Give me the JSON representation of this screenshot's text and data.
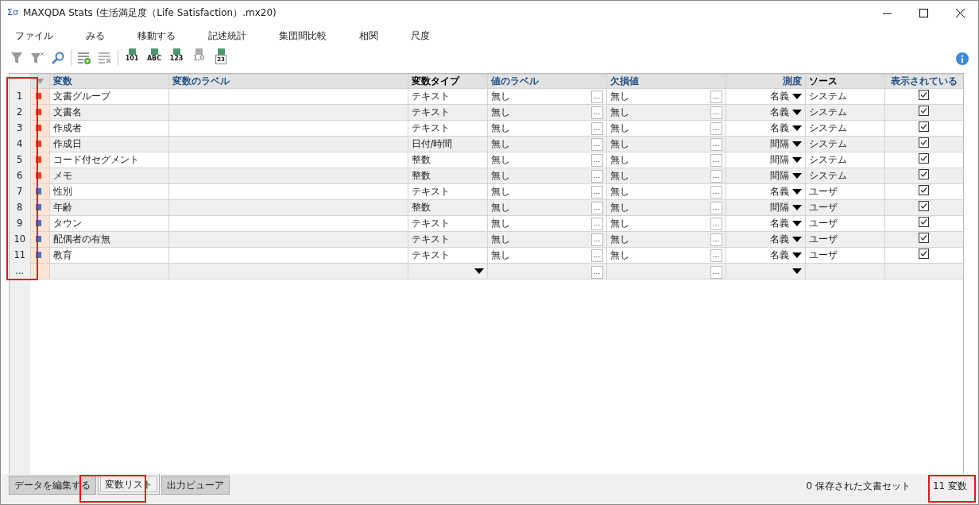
{
  "window": {
    "app_icon": "Σσ",
    "title": "MAXQDA Stats (生活満足度（Life Satisfaction）.mx20)"
  },
  "menu": [
    "ファイル",
    "みる",
    "移動する",
    "記述統計",
    "集団間比較",
    "相関",
    "尺度"
  ],
  "toolbar": [
    {
      "kind": "filter",
      "disabled": true
    },
    {
      "kind": "filter-clear",
      "disabled": true
    },
    {
      "kind": "search",
      "disabled": false
    },
    {
      "kind": "separator"
    },
    {
      "kind": "list-add",
      "disabled": false
    },
    {
      "kind": "list-remove",
      "disabled": true
    },
    {
      "kind": "separator"
    },
    {
      "kind": "convert",
      "label": "101",
      "disabled": false
    },
    {
      "kind": "convert",
      "label": "ABC",
      "disabled": false
    },
    {
      "kind": "convert",
      "label": "123",
      "disabled": false
    },
    {
      "kind": "convert",
      "label": "1,0",
      "disabled": true
    },
    {
      "kind": "calendar",
      "label": "23",
      "disabled": false
    }
  ],
  "table": {
    "columns": [
      {
        "label": "変数",
        "editable": true
      },
      {
        "label": "変数のラベル",
        "editable": true
      },
      {
        "label": "変数タイプ",
        "editable": false
      },
      {
        "label": "値のラベル",
        "editable": true
      },
      {
        "label": "欠損値",
        "editable": true
      },
      {
        "label": "測度",
        "editable": true
      },
      {
        "label": "ソース",
        "editable": false
      },
      {
        "label": "表示されている",
        "editable": true
      }
    ],
    "rows": [
      {
        "number": "1",
        "color": "#e8402a",
        "name": "文書グループ",
        "type": "テキスト",
        "value_label": "無し",
        "value_label_button": "...",
        "missing": "無し",
        "missing_button": "...",
        "measure": "名義",
        "source": "システム",
        "shown": true
      },
      {
        "number": "2",
        "color": "#e8402a",
        "name": "文書名",
        "type": "テキスト",
        "value_label": "無し",
        "value_label_button": "...",
        "missing": "無し",
        "missing_button": "...",
        "measure": "名義",
        "source": "システム",
        "shown": true
      },
      {
        "number": "3",
        "color": "#e8402a",
        "name": "作成者",
        "type": "テキスト",
        "value_label": "無し",
        "value_label_button": "...",
        "missing": "無し",
        "missing_button": "...",
        "measure": "名義",
        "source": "システム",
        "shown": true
      },
      {
        "number": "4",
        "color": "#e8402a",
        "name": "作成日",
        "type": "日付/時間",
        "value_label": "無し",
        "value_label_button": "...",
        "missing": "無し",
        "missing_button": "...",
        "measure": "間隔",
        "source": "システム",
        "shown": true
      },
      {
        "number": "5",
        "color": "#e8402a",
        "name": "コード付セグメント",
        "type": "整数",
        "value_label": "無し",
        "value_label_button": "...",
        "missing": "無し",
        "missing_button": "...",
        "measure": "間隔",
        "source": "システム",
        "shown": true
      },
      {
        "number": "6",
        "color": "#e8402a",
        "name": "メモ",
        "type": "整数",
        "value_label": "無し",
        "value_label_button": "...",
        "missing": "無し",
        "missing_button": "...",
        "measure": "間隔",
        "source": "システム",
        "shown": true
      },
      {
        "number": "7",
        "color": "#3d7ab8",
        "name": "性別",
        "type": "テキスト",
        "value_label": "無し",
        "value_label_button": "...",
        "missing": "無し",
        "missing_button": "...",
        "measure": "名義",
        "source": "ユーザ",
        "shown": true
      },
      {
        "number": "8",
        "color": "#3d7ab8",
        "name": "年齢",
        "type": "整数",
        "value_label": "無し",
        "value_label_button": "...",
        "missing": "無し",
        "missing_button": "...",
        "measure": "間隔",
        "source": "ユーザ",
        "shown": true
      },
      {
        "number": "9",
        "color": "#3d7ab8",
        "name": "タウン",
        "type": "テキスト",
        "value_label": "無し",
        "value_label_button": "...",
        "missing": "無し",
        "missing_button": "...",
        "measure": "名義",
        "source": "ユーザ",
        "shown": true
      },
      {
        "number": "10",
        "color": "#3d7ab8",
        "name": "配偶者の有無",
        "type": "テキスト",
        "value_label": "無し",
        "value_label_button": "...",
        "missing": "無し",
        "missing_button": "...",
        "measure": "名義",
        "source": "ユーザ",
        "shown": true
      },
      {
        "number": "11",
        "color": "#3d7ab8",
        "name": "教育",
        "type": "テキスト",
        "value_label": "無し",
        "value_label_button": "...",
        "missing": "無し",
        "missing_button": "...",
        "measure": "名義",
        "source": "ユーザ",
        "shown": true
      }
    ],
    "new_row": {
      "number": "...",
      "value_label_button": "...",
      "missing_button": "..."
    }
  },
  "bottom_tabs": [
    {
      "label": "データを編集する",
      "selected": false
    },
    {
      "label": "変数リスト",
      "selected": true
    },
    {
      "label": "出力ビューア",
      "selected": false
    }
  ],
  "status_bar": {
    "saved_sets": "0 保存された文書セット",
    "variable_count": "11 変数"
  }
}
